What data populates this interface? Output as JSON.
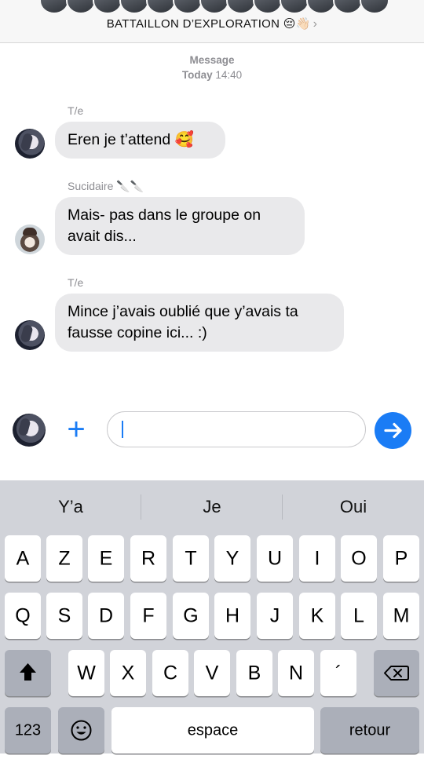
{
  "header": {
    "title": "BATTAILLON D’EXPLORATION 😔👋🏻",
    "chevron": "›"
  },
  "timestamp": {
    "line1": "Message",
    "day": "Today",
    "time": "14:40"
  },
  "messages": [
    {
      "sender": "T/e",
      "text": "Eren je t’attend 🥰"
    },
    {
      "sender": "Sucidaire 🔪🔪",
      "text_line1": "Mais- pas dans le groupe on",
      "text_line2": "avait dis..."
    },
    {
      "sender": "T/e",
      "text_line1": "Mince j’avais oublié que y’avais ta",
      "text_line2": "fausse copine ici... :)"
    }
  ],
  "composer": {
    "plus": "+",
    "send_icon": "arrow-up"
  },
  "keyboard": {
    "suggestions": [
      "Y’a",
      "Je",
      "Oui"
    ],
    "row1": [
      "A",
      "Z",
      "E",
      "R",
      "T",
      "Y",
      "U",
      "I",
      "O",
      "P"
    ],
    "row2": [
      "Q",
      "S",
      "D",
      "F",
      "G",
      "H",
      "J",
      "K",
      "L",
      "M"
    ],
    "row3": [
      "W",
      "X",
      "C",
      "V",
      "B",
      "N",
      "´"
    ],
    "numbers": "123",
    "space": "espace",
    "return": "retour"
  },
  "colors": {
    "accent": "#1a7cf5",
    "bubble": "#e9e9eb",
    "keyboard": "#d1d3d9"
  }
}
